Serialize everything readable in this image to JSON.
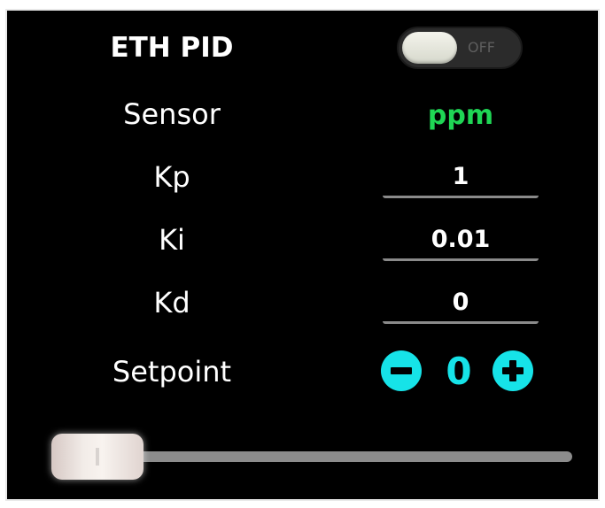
{
  "panel": {
    "title": "ETH PID",
    "toggle": {
      "state_label": "OFF",
      "on": false
    }
  },
  "rows": {
    "sensor": {
      "label": "Sensor",
      "value": "ppm",
      "color": "#1fd655"
    },
    "kp": {
      "label": "Kp",
      "value": "1"
    },
    "ki": {
      "label": "Ki",
      "value": "0.01"
    },
    "kd": {
      "label": "Kd",
      "value": "0"
    },
    "setpoint": {
      "label": "Setpoint",
      "value": "0",
      "accent": "#16e3e8"
    }
  },
  "slider": {
    "level": 0
  },
  "icons": {
    "minus": "minus-circle-icon",
    "plus": "plus-circle-icon"
  }
}
